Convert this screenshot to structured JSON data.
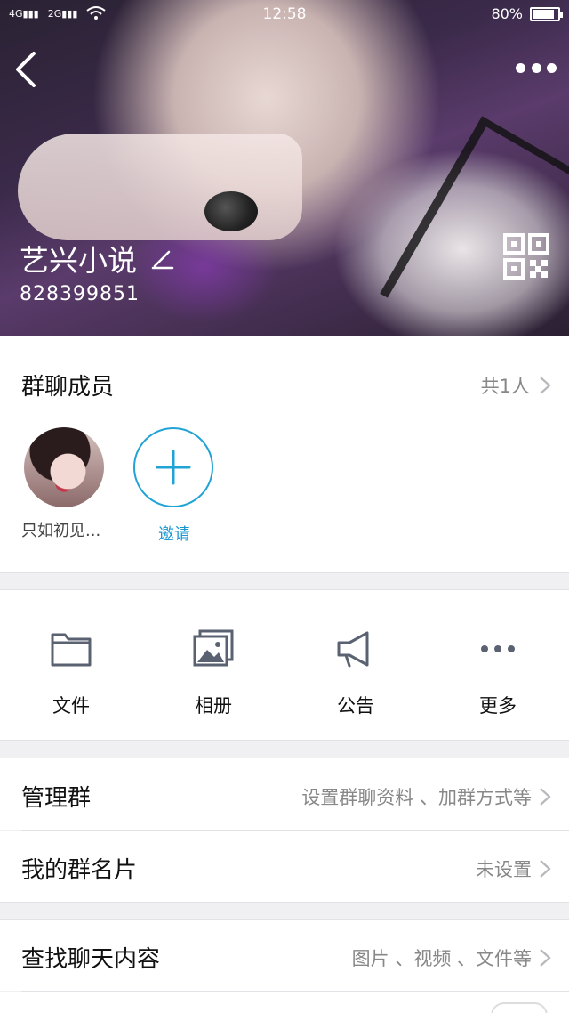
{
  "status_bar": {
    "network_1": "4G",
    "network_2": "2G",
    "time": "12:58",
    "battery": "80%",
    "battery_level": 0.8
  },
  "header": {
    "group_name": "艺兴小说",
    "group_id": "828399851"
  },
  "members": {
    "title": "群聊成员",
    "count": "共1人",
    "items": [
      {
        "name": "只如初见..."
      }
    ],
    "invite_label": "邀请"
  },
  "actions": [
    {
      "label": "文件",
      "icon": "folder-icon"
    },
    {
      "label": "相册",
      "icon": "album-icon"
    },
    {
      "label": "公告",
      "icon": "megaphone-icon"
    },
    {
      "label": "更多",
      "icon": "more-icon"
    }
  ],
  "settings": {
    "manage_group": {
      "label": "管理群",
      "value": "设置群聊资料 、加群方式等"
    },
    "my_group_card": {
      "label": "我的群名片",
      "value": "未设置"
    },
    "search_chat": {
      "label": "查找聊天内容",
      "value": "图片 、视频 、文件等"
    }
  },
  "colors": {
    "accent": "#21a3d6",
    "icon_gray": "#5a6272",
    "secondary_text": "#888888"
  }
}
